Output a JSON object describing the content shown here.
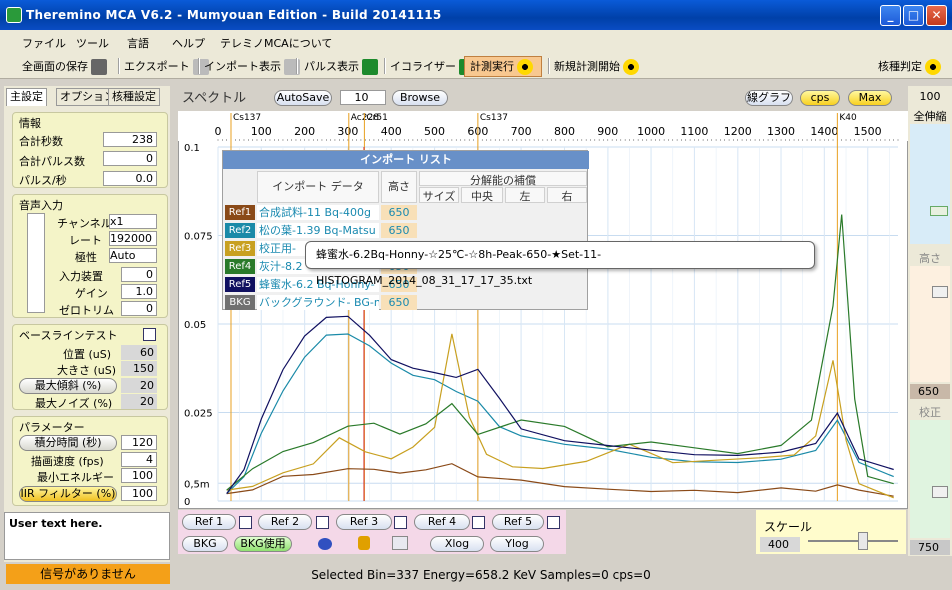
{
  "window": {
    "title": "Theremino MCA V6.2  - Mumyouan Edition -  Build 20141115"
  },
  "menu": [
    "ファイル",
    "ツール",
    "言語",
    "ヘルプ",
    "テレミノMCAについて"
  ],
  "toolbar": {
    "save": "全画面の保存",
    "export": "エクスポート",
    "import": "インポート表示",
    "pulse": "パルス表示",
    "equalizer": "イコライザー",
    "run": "計測実行",
    "new_run": "新規計測開始",
    "nuclide": "核種判定"
  },
  "tabs": [
    "主設定",
    "オプション",
    "核種設定"
  ],
  "info": {
    "title": "情報",
    "total_sec_label": "合計秒数",
    "total_sec": "238",
    "total_pulse_label": "合計パルス数",
    "total_pulse": "0",
    "pulse_per_sec_label": "パルス/秒",
    "pulse_per_sec": "0.0"
  },
  "audio": {
    "title": "音声入力",
    "channel_label": "チャンネル",
    "channel": "x1",
    "rate_label": "レート",
    "rate": "192000",
    "polarity_label": "極性",
    "polarity": "Auto",
    "device_label": "入力装置",
    "device": "0",
    "gain_label": "ゲイン",
    "gain": "1.0",
    "zero_label": "ゼロトリム",
    "zero": "0"
  },
  "baseline": {
    "title": "ベースラインテスト",
    "pos_label": "位置 (uS)",
    "pos": "60",
    "size_label": "大きさ (uS)",
    "size": "150",
    "slope_label": "最大傾斜 (%)",
    "slope": "20",
    "noise_label": "最大ノイズ (%)",
    "noise": "20"
  },
  "params": {
    "title": "パラメーター",
    "integ_label": "積分時間 (秒)",
    "integ": "120",
    "fps_label": "描画速度 (fps)",
    "fps": "4",
    "minE_label": "最小エネルギー",
    "minE": "100",
    "iir_label": "IIR フィルター (%)",
    "iir": "100"
  },
  "user_text": "User text here.",
  "signal": "信号がありません",
  "spectrum": {
    "title": "スペクトル",
    "autosave": "AutoSave",
    "autosave_val": "10",
    "browse": "Browse",
    "line_graph": "線グラフ",
    "cps": "cps",
    "max": "Max"
  },
  "import_list": {
    "title": "インポート リスト",
    "col_data": "インポート データ",
    "col_height": "高さ",
    "col_comp": "分解能の補償",
    "col_size": "サイズ",
    "col_center": "中央",
    "col_left": "左",
    "col_right": "右",
    "rows": [
      {
        "tag": "Ref1",
        "name": "合成試料-11 Bq-400g",
        "h": "650",
        "color": "#8a4a18"
      },
      {
        "tag": "Ref2",
        "name": "松の葉-1.39 Bq-Matsu",
        "h": "650",
        "color": "#1a8aa8"
      },
      {
        "tag": "Ref3",
        "name": "校正用-",
        "h": "650",
        "color": "#c8a020"
      },
      {
        "tag": "Ref4",
        "name": "灰汁-8.2",
        "h": "650",
        "color": "#2a7a2a"
      },
      {
        "tag": "Ref5",
        "name": "蜂蜜水-6.2 Bq-Honny-",
        "h": "650",
        "color": "#101060"
      },
      {
        "tag": "BKG",
        "name": "バックグラウンド- BG-n",
        "h": "650",
        "color": "#707070"
      }
    ]
  },
  "tooltip": "蜂蜜水-6.2Bq-Honny-☆25℃-☆8h-Peak-650-★Set-11-HISTOGRAM_2014_08_31_17_17_35.txt",
  "bottom": {
    "ref1": "Ref 1",
    "ref2": "Ref 2",
    "ref3": "Ref 3",
    "ref4": "Ref 4",
    "ref5": "Ref 5",
    "bkg": "BKG",
    "bkg_use": "BKG使用",
    "xlog": "Xlog",
    "ylog": "Ylog"
  },
  "scale": {
    "label": "スケール",
    "value": "400"
  },
  "right": {
    "top": "100",
    "zoom": "全伸縮",
    "height": "高さ",
    "height_val": "650",
    "calib": "校正",
    "calib_val": "750"
  },
  "status": "Selected Bin=337  Energy=658.2 KeV  Samples=0  cps=0",
  "chart_data": {
    "type": "line",
    "x_ticks": [
      "0",
      "100",
      "200",
      "300",
      "400",
      "500",
      "600",
      "700",
      "800",
      "900",
      "1000",
      "1100",
      "1200",
      "1300",
      "1400",
      "1500"
    ],
    "y_ticks": [
      "0.1",
      "0.075",
      "0.05",
      "0.025",
      "0,5m",
      "0"
    ],
    "markers": [
      "Cs137",
      "Ac228",
      "Cr51",
      "Cs137",
      "K40"
    ],
    "xlim": [
      0,
      1570
    ],
    "ylim": [
      0,
      0.1
    ],
    "series": [
      {
        "name": "Ref1",
        "color": "#8a4a18",
        "x": [
          20,
          80,
          150,
          220,
          300,
          360,
          420,
          480,
          540,
          600,
          700,
          800,
          900,
          1000,
          1100,
          1200,
          1300,
          1380,
          1430,
          1480,
          1560
        ],
        "y": [
          0.001,
          0.004,
          0.006,
          0.007,
          0.008,
          0.009,
          0.009,
          0.008,
          0.01,
          0.008,
          0.007,
          0.005,
          0.004,
          0.003,
          0.003,
          0.002,
          0.003,
          0.003,
          0.004,
          0.002,
          0.001
        ]
      },
      {
        "name": "Ref2",
        "color": "#1a8aa8",
        "x": [
          20,
          60,
          100,
          150,
          200,
          250,
          300,
          350,
          400,
          450,
          500,
          550,
          600,
          650,
          700,
          800,
          900,
          1000,
          1100,
          1200,
          1300,
          1380,
          1430,
          1480,
          1560
        ],
        "y": [
          0.001,
          0.008,
          0.018,
          0.03,
          0.04,
          0.047,
          0.048,
          0.045,
          0.04,
          0.036,
          0.034,
          0.03,
          0.027,
          0.02,
          0.018,
          0.016,
          0.015,
          0.013,
          0.012,
          0.012,
          0.013,
          0.015,
          0.024,
          0.012,
          0.008
        ]
      },
      {
        "name": "Ref3",
        "color": "#c8a020",
        "x": [
          20,
          80,
          150,
          220,
          280,
          340,
          400,
          450,
          500,
          540,
          580,
          620,
          680,
          750,
          850,
          950,
          1050,
          1150,
          1250,
          1330,
          1380,
          1420,
          1450,
          1480,
          1560
        ],
        "y": [
          0.002,
          0.005,
          0.007,
          0.01,
          0.017,
          0.015,
          0.012,
          0.016,
          0.022,
          0.046,
          0.025,
          0.012,
          0.01,
          0.008,
          0.01,
          0.015,
          0.01,
          0.011,
          0.012,
          0.012,
          0.018,
          0.04,
          0.018,
          0.006,
          0.002
        ]
      },
      {
        "name": "Ref4",
        "color": "#2a7a2a",
        "x": [
          20,
          80,
          150,
          220,
          300,
          360,
          420,
          480,
          540,
          600,
          700,
          800,
          900,
          1000,
          1100,
          1200,
          1300,
          1370,
          1420,
          1440,
          1470,
          1500,
          1560
        ],
        "y": [
          0.002,
          0.01,
          0.013,
          0.016,
          0.02,
          0.022,
          0.02,
          0.021,
          0.027,
          0.02,
          0.024,
          0.022,
          0.016,
          0.017,
          0.015,
          0.013,
          0.015,
          0.022,
          0.055,
          0.082,
          0.03,
          0.008,
          0.004
        ]
      },
      {
        "name": "Ref5",
        "color": "#101060",
        "x": [
          20,
          60,
          100,
          150,
          200,
          250,
          300,
          350,
          400,
          450,
          500,
          550,
          600,
          650,
          700,
          800,
          900,
          1000,
          1100,
          1200,
          1300,
          1380,
          1430,
          1480,
          1560
        ],
        "y": [
          0.001,
          0.01,
          0.022,
          0.036,
          0.046,
          0.052,
          0.053,
          0.048,
          0.041,
          0.038,
          0.036,
          0.034,
          0.036,
          0.028,
          0.02,
          0.017,
          0.016,
          0.015,
          0.014,
          0.014,
          0.015,
          0.017,
          0.026,
          0.013,
          0.01
        ]
      }
    ]
  }
}
